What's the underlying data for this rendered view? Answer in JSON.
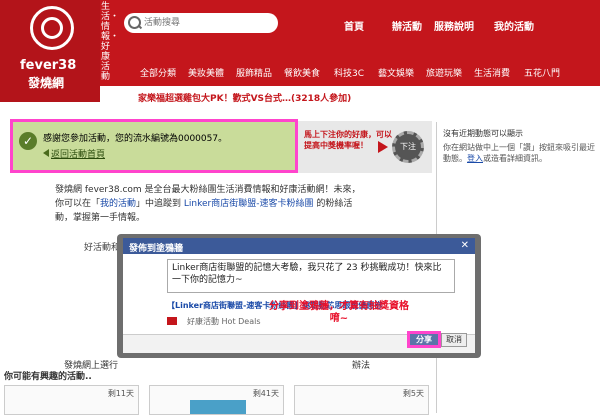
{
  "brand": {
    "name": "fever38",
    "name_cn": "發燒網",
    "slogan": "生活・情報・好康活動"
  },
  "search": {
    "placeholder": "活動搜尋"
  },
  "topnav": [
    "首頁",
    "辦活動",
    "服務說明",
    "我的活動"
  ],
  "catnav": [
    "全部分類",
    "美妝美體",
    "服飾精品",
    "餐飲美食",
    "科技3C",
    "藝文娛樂",
    "旅遊玩樂",
    "生活消費",
    "五花八門"
  ],
  "ticker": "家樂福超選雞包大PK！歡式VS台式…(3218人參加)",
  "notice": {
    "message": "感謝您參加活動，您的流水編號為0000057。",
    "back_link": "返回活動首頁"
  },
  "promo": {
    "text": "馬上下注你的好康，可以提高中獎機率喔！",
    "button": "下注"
  },
  "intro": {
    "line1": "發燒網 fever38.com 是全台最大粉絲團生活消費情報和好康活動網！未來，",
    "line2_pre": "你可以在「",
    "line2_link": "我的活動",
    "line2_mid": "」中追蹤到 ",
    "line2_link2": "Linker商店街聯盟-速客卡粉絲團",
    "line2_post": " 的粉絲活",
    "line3": "動，掌握第一手情報。"
  },
  "good_title": "好活動和",
  "rules": "發燒網上選行",
  "rules_right": "辦法",
  "you_like": "你可能有興趣的活動..",
  "cards": [
    "剩11天",
    "剩41天",
    "剩5天"
  ],
  "sidebar": {
    "title": "沒有近期動態可以顯示",
    "note": "你在網站做中上一個「讚」按鈕來吸引最近動態。",
    "note_link": "登入",
    "note_tail": "或造看詳細資訊。"
  },
  "dialog": {
    "title": "發佈到塗鴉牆",
    "close": "✕",
    "message": "Linker商店街聯盟的記憶大考驗，我只花了 23 秒挑戰成功！快來比一下你的記憶力~",
    "sub": "【Linker商店街聯盟-速客卡粉絲團】挑戰動芯思眼鏡優惠券",
    "deal_label": "好康活動 Hot Deals",
    "annotation": "分享到塗鴉牆，才算有抽獎資格唷~",
    "share": "分享",
    "cancel": "取消"
  }
}
